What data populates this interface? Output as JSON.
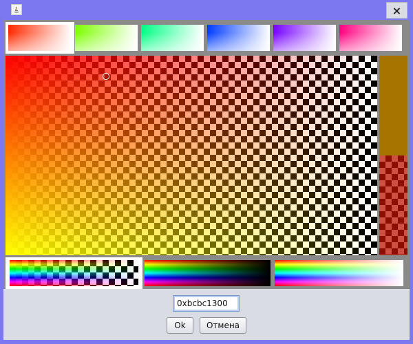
{
  "window": {
    "app_icon": "java-icon",
    "close_label": "×",
    "frame_color": "#7b78f0"
  },
  "hue_tabs": [
    {
      "name": "red",
      "from": "#ff2a00",
      "to": "#ffffff",
      "selected": true
    },
    {
      "name": "yellow-green",
      "from": "#7dff00",
      "to": "#ffffff",
      "selected": false
    },
    {
      "name": "green",
      "from": "#00ff84",
      "to": "#ffffff",
      "selected": false
    },
    {
      "name": "cyan-blue",
      "from": "#003cff",
      "to": "#ffffff",
      "selected": false
    },
    {
      "name": "violet",
      "from": "#7600ff",
      "to": "#ffffff",
      "selected": false
    },
    {
      "name": "magenta",
      "from": "#ff0080",
      "to": "#ffffff",
      "selected": false
    }
  ],
  "main_picker": {
    "top_left": "#ff0000",
    "bottom_left": "#ffff00",
    "cursor_color": "#ffffff"
  },
  "side_preview": {
    "opaque_color": "#a77400",
    "alpha_color": "#bc1300",
    "alpha": 0.74
  },
  "mode_strips": [
    {
      "name": "alpha-rainbow",
      "selected": true
    },
    {
      "name": "dark-rainbow",
      "selected": false
    },
    {
      "name": "light-rainbow",
      "selected": false
    }
  ],
  "color_input": {
    "value": "0xbcbc1300"
  },
  "buttons": {
    "ok_label": "Ok",
    "cancel_label": "Отмена"
  }
}
